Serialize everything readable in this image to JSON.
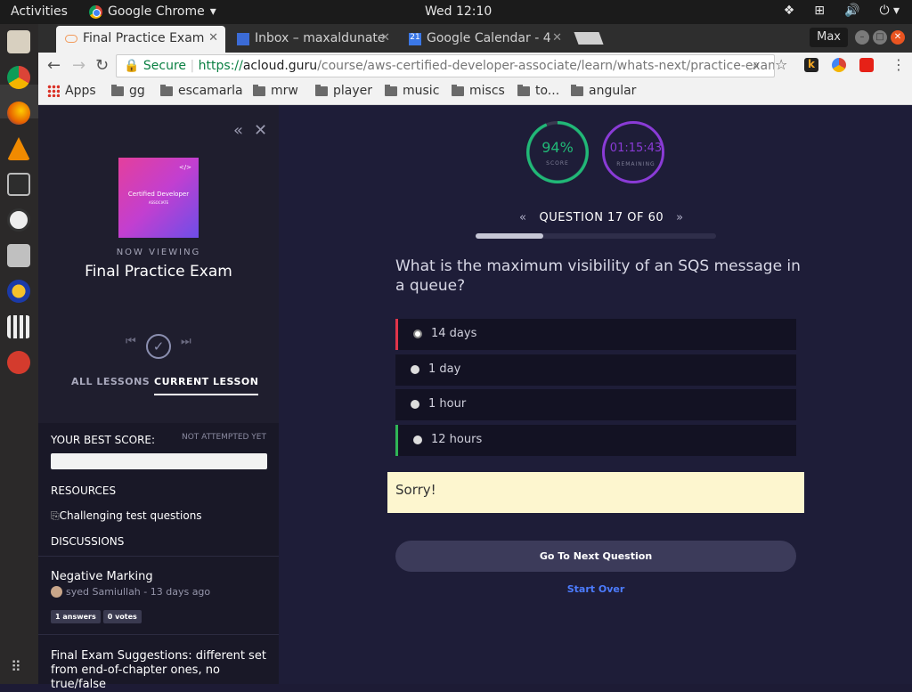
{
  "system": {
    "activities": "Activities",
    "app_name": "Google Chrome",
    "clock": "Wed 12:10"
  },
  "browser": {
    "tabs": [
      {
        "label": "Final Practice Exam",
        "active": true
      },
      {
        "label": "Inbox – maxaldunate",
        "active": false
      },
      {
        "label": "Google Calendar - 4",
        "active": false
      }
    ],
    "profile_button": "Max",
    "address": {
      "secure_label": "Secure",
      "scheme": "https://",
      "host": "acloud.guru",
      "path": "/course/aws-certified-developer-associate/learn/whats-next/practice-exam/..."
    },
    "bookmarks": [
      "Apps",
      "gg",
      "escamarla",
      "mrw",
      "player",
      "music",
      "miscs",
      "to...",
      "angular"
    ]
  },
  "sidebar": {
    "thumbnail": {
      "title": "Certified Developer",
      "subtitle": "ASSOCIATE",
      "code": "</>"
    },
    "now_viewing": "NOW VIEWING",
    "lesson_title": "Final Practice Exam",
    "tabs": {
      "all": "ALL LESSONS",
      "current": "CURRENT LESSON"
    },
    "best_score_label": "YOUR BEST SCORE:",
    "best_score_status": "NOT ATTEMPTED YET",
    "resources_label": "RESOURCES",
    "resource_item": "Challenging test questions",
    "discussions_label": "DISCUSSIONS",
    "discussions": [
      {
        "title": "Negative Marking",
        "meta": "syed Samiullah - 13 days ago",
        "answers": "1 answers",
        "votes": "0 votes"
      },
      {
        "title": "Final Exam Suggestions: different set from end-of-chapter ones, no true/false",
        "meta": ""
      }
    ]
  },
  "exam": {
    "score": {
      "value": "94%",
      "label": "SCORE",
      "fraction": 0.94,
      "color": "#21b877"
    },
    "remaining": {
      "value": "01:15:43",
      "label": "REMAINING",
      "color": "#8a3bd6"
    },
    "question_header": "QUESTION 17 OF 60",
    "progress_fraction": 0.28,
    "question": "What is the maximum visibility of an SQS message in a queue?",
    "options": [
      {
        "label": "14 days",
        "state": "selected-wrong"
      },
      {
        "label": "1 day",
        "state": "none"
      },
      {
        "label": "1 hour",
        "state": "none"
      },
      {
        "label": "12 hours",
        "state": "correct"
      }
    ],
    "feedback": "Sorry!",
    "next_button": "Go To Next Question",
    "start_over": "Start Over"
  }
}
